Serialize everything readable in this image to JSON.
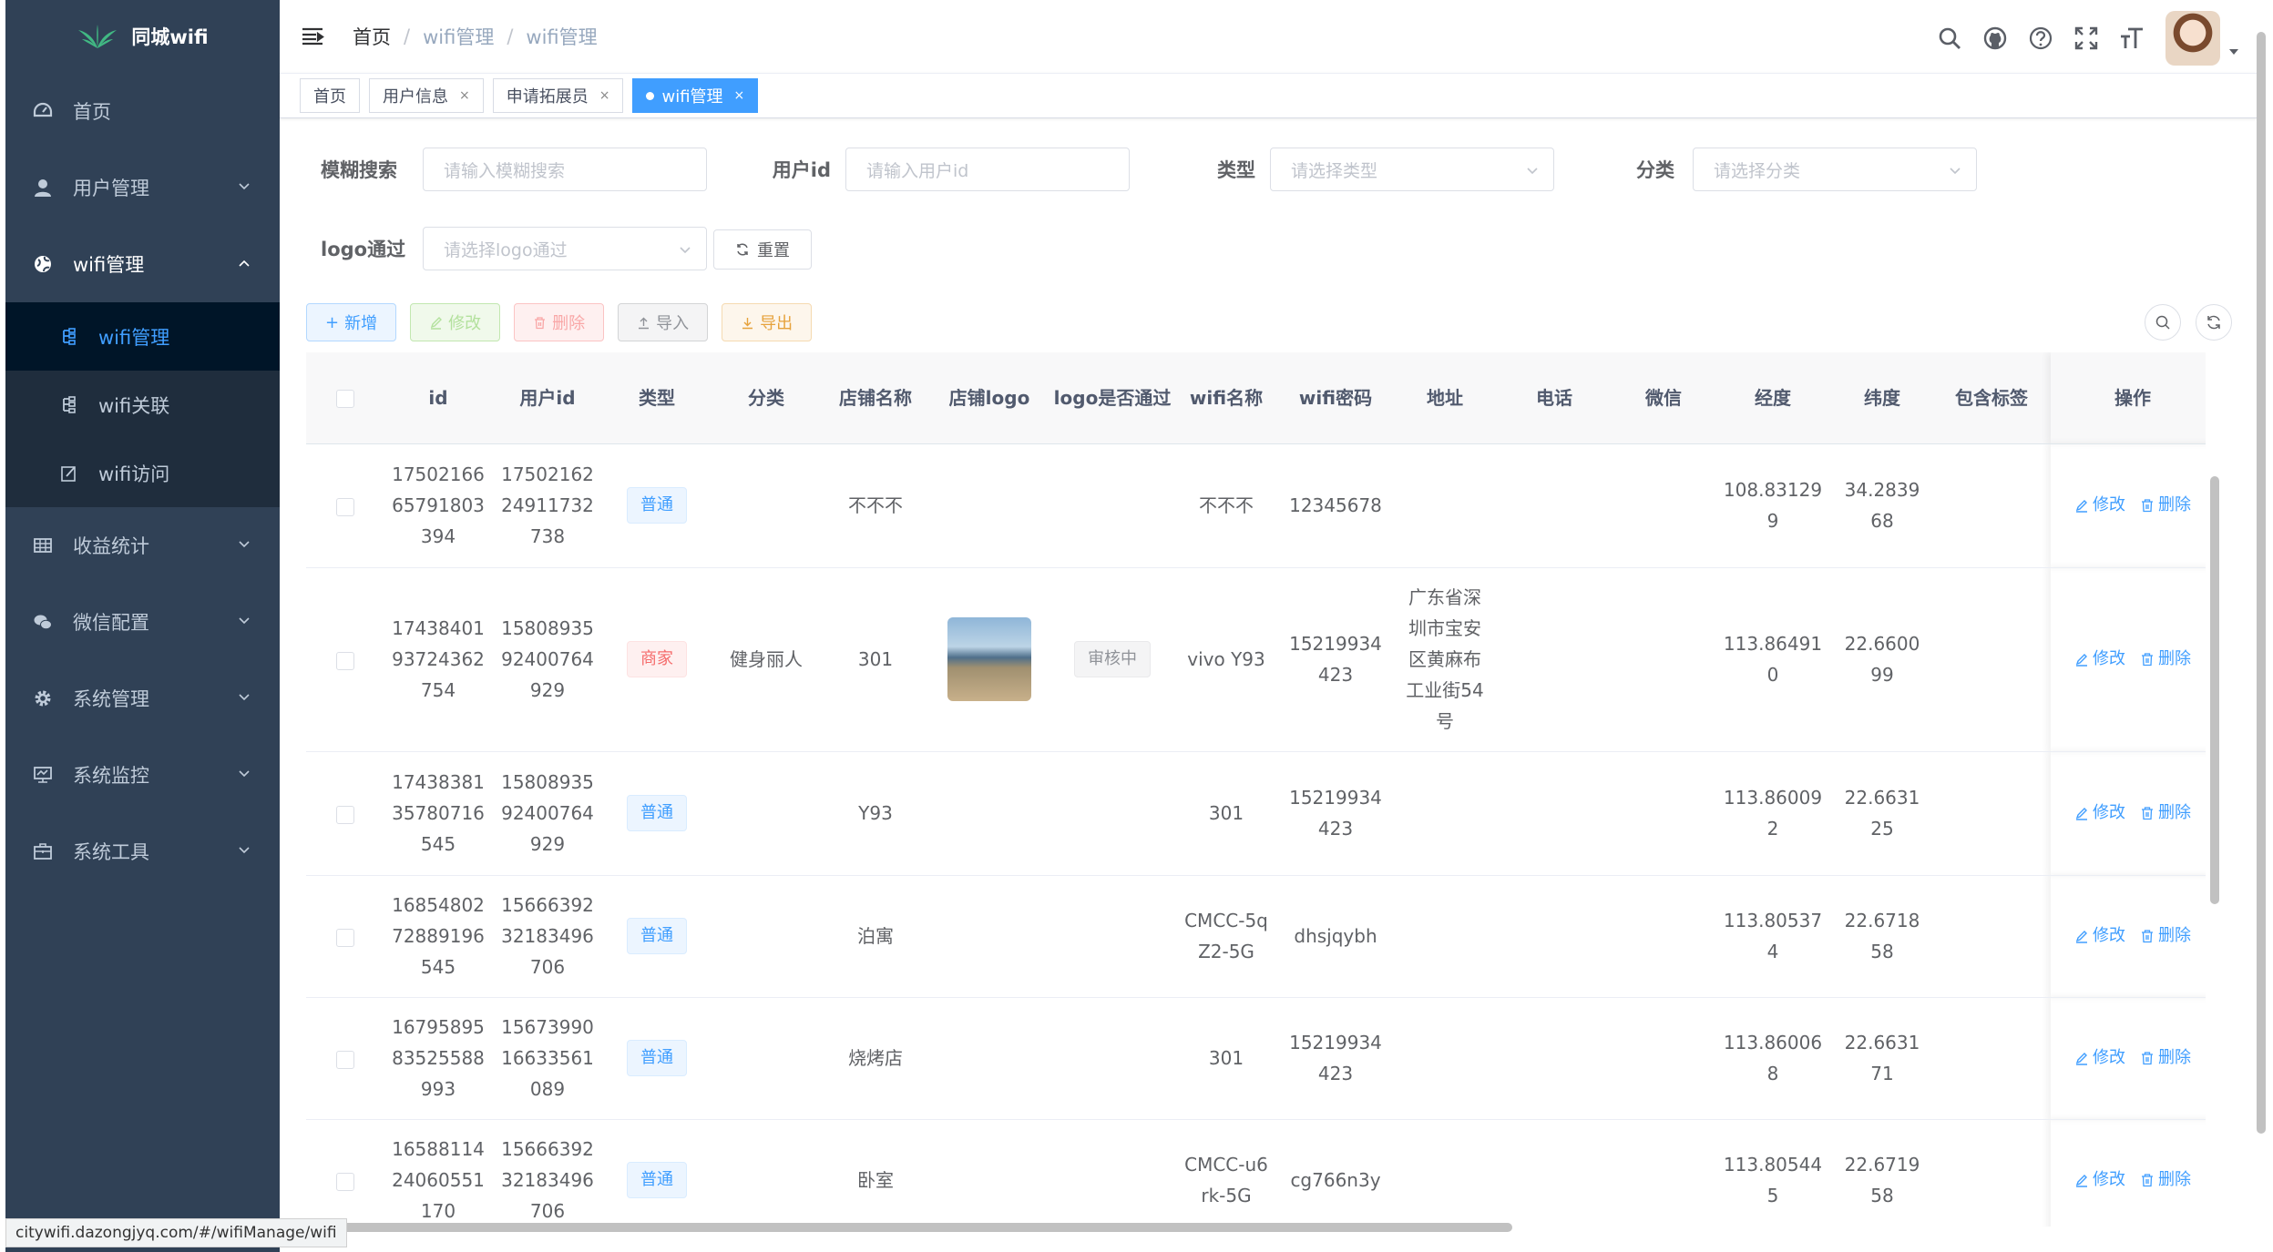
{
  "app": {
    "logo_text": "同城wifi"
  },
  "sidebar": {
    "items": [
      {
        "label": "首页",
        "icon": "dashboard-icon"
      },
      {
        "label": "用户管理",
        "icon": "user-icon"
      },
      {
        "label": "wifi管理",
        "icon": "globe-icon",
        "open": true,
        "children": [
          {
            "label": "wifi管理",
            "active": true
          },
          {
            "label": "wifi关联"
          },
          {
            "label": "wifi访问"
          }
        ]
      },
      {
        "label": "收益统计",
        "icon": "table-icon"
      },
      {
        "label": "微信配置",
        "icon": "wechat-icon"
      },
      {
        "label": "系统管理",
        "icon": "gear-icon"
      },
      {
        "label": "系统监控",
        "icon": "monitor-icon"
      },
      {
        "label": "系统工具",
        "icon": "toolbox-icon"
      }
    ]
  },
  "breadcrumb": [
    "首页",
    "wifi管理",
    "wifi管理"
  ],
  "tags": [
    {
      "label": "首页"
    },
    {
      "label": "用户信息",
      "closable": true
    },
    {
      "label": "申请拓展员",
      "closable": true
    },
    {
      "label": "wifi管理",
      "closable": true,
      "active": true
    }
  ],
  "search": {
    "keyword_label": "模糊搜索",
    "keyword_placeholder": "请输入模糊搜索",
    "userid_label": "用户id",
    "userid_placeholder": "请输入用户id",
    "type_label": "类型",
    "type_placeholder": "请选择类型",
    "category_label": "分类",
    "category_placeholder": "请选择分类",
    "logo_label": "logo通过",
    "logo_placeholder": "请选择logo通过",
    "reset_label": "重置"
  },
  "toolbar": {
    "add": "新增",
    "edit": "修改",
    "delete": "删除",
    "import": "导入",
    "export": "导出"
  },
  "table": {
    "headers": [
      "id",
      "用户id",
      "类型",
      "分类",
      "店铺名称",
      "店铺logo",
      "logo是否通过",
      "wifi名称",
      "wifi密码",
      "地址",
      "电话",
      "微信",
      "经度",
      "纬度",
      "包含标签",
      "操作"
    ],
    "op_edit": "修改",
    "op_delete": "删除",
    "rows": [
      {
        "id": "1750216665791803394",
        "userid": "1750216224911732738",
        "type": "普通",
        "type_kind": "normal",
        "category": "",
        "shop": "不不不",
        "logo": false,
        "logo_pass": "",
        "wifi": "不不不",
        "pwd": "12345678",
        "addr": "",
        "phone": "",
        "wechat": "",
        "lng": "108.831299",
        "lat": "34.283968",
        "tags": ""
      },
      {
        "id": "1743840193724362754",
        "userid": "1580893592400764929",
        "type": "商家",
        "type_kind": "merchant",
        "category": "健身丽人",
        "shop": "301",
        "logo": true,
        "logo_pass": "审核中",
        "wifi": "vivo Y93",
        "pwd": "15219934423",
        "addr": "广东省深圳市宝安区黄麻布工业街54号",
        "phone": "",
        "wechat": "",
        "lng": "113.864910",
        "lat": "22.660099",
        "tags": ""
      },
      {
        "id": "1743838135780716545",
        "userid": "1580893592400764929",
        "type": "普通",
        "type_kind": "normal",
        "category": "",
        "shop": "Y93",
        "logo": false,
        "logo_pass": "",
        "wifi": "301",
        "pwd": "15219934423",
        "addr": "",
        "phone": "",
        "wechat": "",
        "lng": "113.860092",
        "lat": "22.663125",
        "tags": ""
      },
      {
        "id": "1685480272889196545",
        "userid": "1566639232183496706",
        "type": "普通",
        "type_kind": "normal",
        "category": "",
        "shop": "泊寓",
        "logo": false,
        "logo_pass": "",
        "wifi": "CMCC-5qZ2-5G",
        "pwd": "dhsjqybh",
        "addr": "",
        "phone": "",
        "wechat": "",
        "lng": "113.805374",
        "lat": "22.671858",
        "tags": ""
      },
      {
        "id": "1679589583525588993",
        "userid": "1567399016633561089",
        "type": "普通",
        "type_kind": "normal",
        "category": "",
        "shop": "烧烤店",
        "logo": false,
        "logo_pass": "",
        "wifi": "301",
        "pwd": "15219934423",
        "addr": "",
        "phone": "",
        "wechat": "",
        "lng": "113.860068",
        "lat": "22.663171",
        "tags": ""
      },
      {
        "id": "1658811424060551170",
        "userid": "1566639232183496706",
        "type": "普通",
        "type_kind": "normal",
        "category": "",
        "shop": "卧室",
        "logo": false,
        "logo_pass": "",
        "wifi": "CMCC-u6rk-5G",
        "pwd": "cg766n3y",
        "addr": "",
        "phone": "",
        "wechat": "",
        "lng": "113.805445",
        "lat": "22.671958",
        "tags": ""
      }
    ]
  },
  "status_url": "citywifi.dazongjyq.com/#/wifiManage/wifi"
}
